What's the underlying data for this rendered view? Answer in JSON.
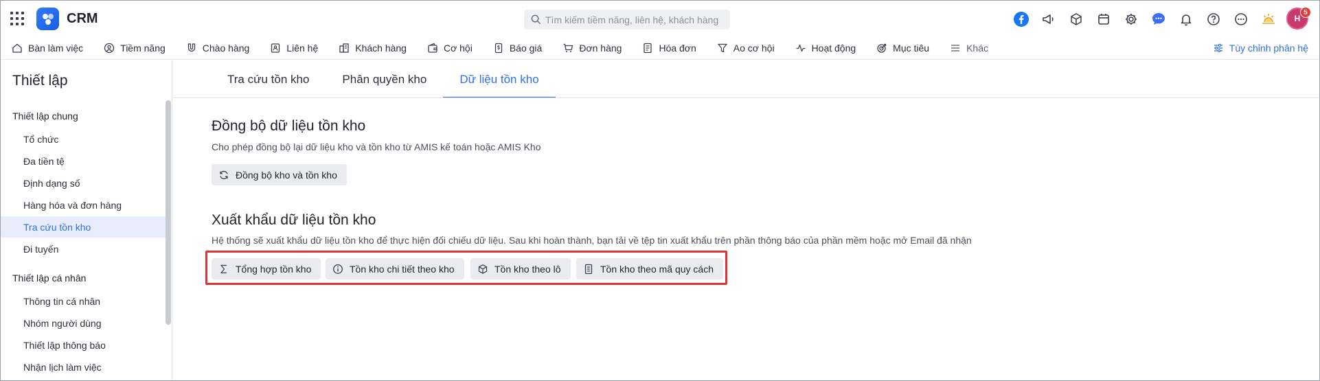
{
  "app": {
    "title": "CRM"
  },
  "search": {
    "placeholder": "Tìm kiếm tiềm năng, liên hệ, khách hàng"
  },
  "user": {
    "initials": "H",
    "notification_count": "5"
  },
  "top_icons": [
    "facebook-icon",
    "megaphone-icon",
    "box-icon",
    "calendar-icon",
    "gear-icon",
    "chat-icon",
    "bell-icon",
    "help-icon",
    "more-icon",
    "sun-icon"
  ],
  "nav": {
    "items": [
      {
        "label": "Bàn làm việc",
        "icon": "home-icon"
      },
      {
        "label": "Tiềm năng",
        "icon": "user-circle-icon"
      },
      {
        "label": "Chào hàng",
        "icon": "magnet-icon"
      },
      {
        "label": "Liên hệ",
        "icon": "contact-card-icon"
      },
      {
        "label": "Khách hàng",
        "icon": "building-icon"
      },
      {
        "label": "Cơ hội",
        "icon": "wallet-icon"
      },
      {
        "label": "Báo giá",
        "icon": "quote-doc-icon"
      },
      {
        "label": "Đơn hàng",
        "icon": "cart-icon"
      },
      {
        "label": "Hóa đơn",
        "icon": "invoice-icon"
      },
      {
        "label": "Ao cơ hội",
        "icon": "funnel-icon"
      },
      {
        "label": "Hoạt động",
        "icon": "activity-icon"
      },
      {
        "label": "Mục tiêu",
        "icon": "target-icon"
      },
      {
        "label": "Khác",
        "icon": "menu-icon"
      }
    ],
    "customize_label": "Tùy chỉnh phân hệ"
  },
  "sidebar": {
    "title": "Thiết lập",
    "general_heading": "Thiết lập chung",
    "general_items": [
      "Tổ chức",
      "Đa tiền tệ",
      "Định dạng số",
      "Hàng hóa và đơn hàng",
      "Tra cứu tồn kho",
      "Đi tuyến"
    ],
    "active_item": "Tra cứu tồn kho",
    "personal_heading": "Thiết lập cá nhân",
    "personal_items": [
      "Thông tin cá nhân",
      "Nhóm người dùng",
      "Thiết lập thông báo",
      "Nhận lịch làm việc"
    ]
  },
  "tabs": [
    {
      "label": "Tra cứu tồn kho",
      "active": false
    },
    {
      "label": "Phân quyền kho",
      "active": false
    },
    {
      "label": "Dữ liệu tồn kho",
      "active": true
    }
  ],
  "sync": {
    "title": "Đồng bộ dữ liệu tồn kho",
    "description": "Cho phép đồng bộ lại dữ liệu kho và tồn kho từ AMIS kế toán hoặc AMIS Kho",
    "button_label": "Đồng bộ kho và tồn kho"
  },
  "export": {
    "title": "Xuất khẩu dữ liệu tồn kho",
    "description": "Hệ thống sẽ xuất khẩu dữ liệu tồn kho để thực hiện đối chiếu dữ liệu. Sau khi hoàn thành, bạn tải về tệp tin xuất khẩu trên phần thông báo của phần mềm hoặc mở Email đã nhận",
    "buttons": [
      {
        "label": "Tổng hợp tồn kho",
        "icon": "sigma-icon"
      },
      {
        "label": "Tồn kho chi tiết theo kho",
        "icon": "info-circle-icon"
      },
      {
        "label": "Tồn kho theo lô",
        "icon": "package-icon"
      },
      {
        "label": "Tồn kho theo mã quy cách",
        "icon": "document-icon"
      }
    ]
  },
  "colors": {
    "accent": "#2f6fe8",
    "highlight": "#e03434",
    "active_bg": "#e8edfb"
  }
}
